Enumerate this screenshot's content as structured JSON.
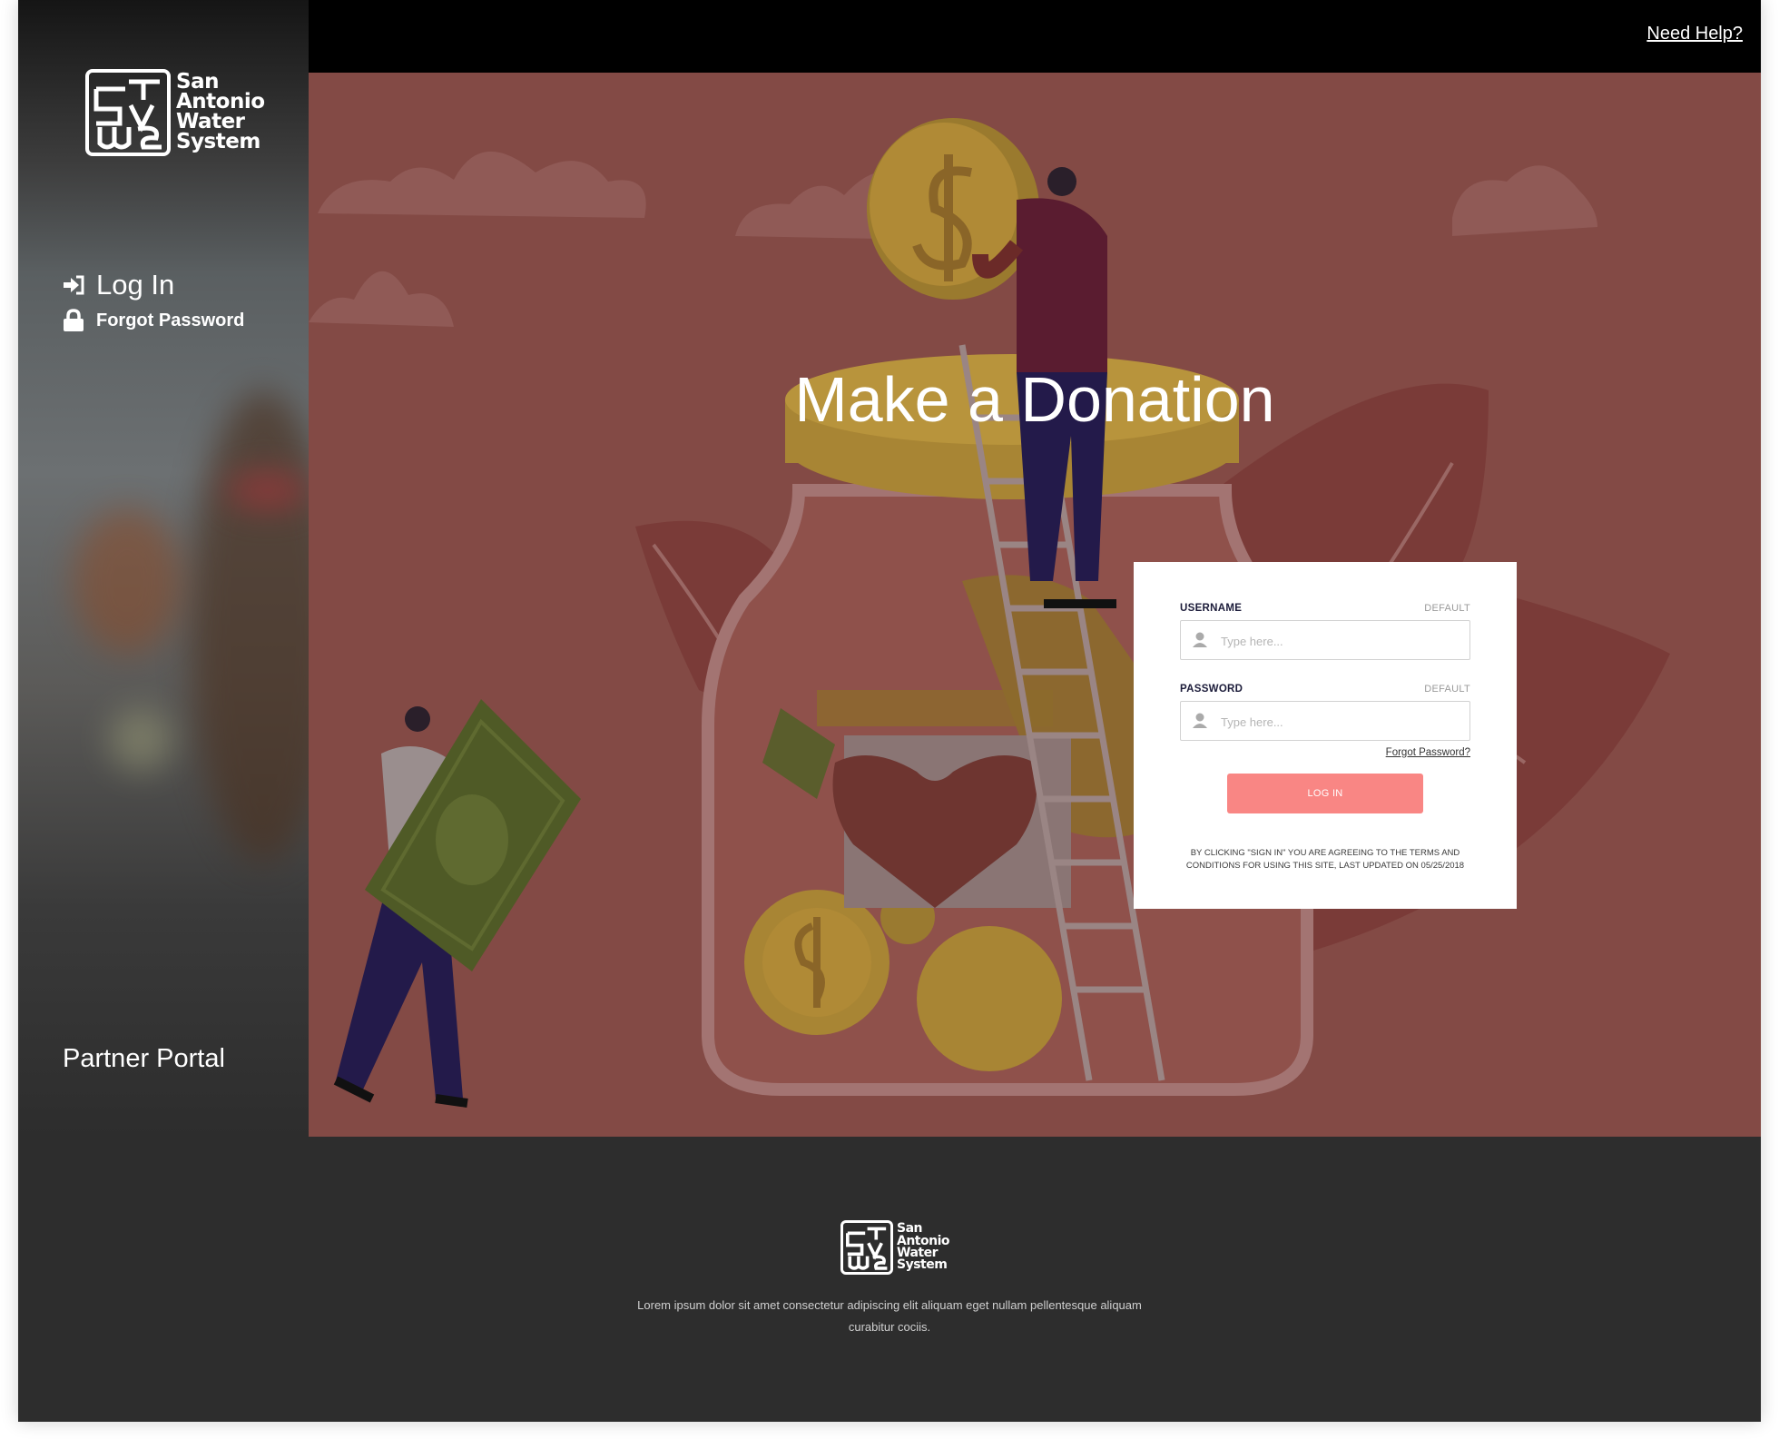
{
  "brand": {
    "name_lines": [
      "San",
      "Antonio",
      "Water",
      "System"
    ],
    "logo_mark": "saws-logo-mark"
  },
  "sidebar": {
    "items": [
      {
        "label": "Log In",
        "icon": "sign-in-icon"
      },
      {
        "label": "Forgot Password",
        "icon": "lock-icon"
      }
    ],
    "portal_label": "Partner Portal"
  },
  "topbar": {
    "help_link": "Need Help?"
  },
  "hero": {
    "headline": "Make a Donation"
  },
  "login": {
    "username_label": "USERNAME",
    "username_hint": "DEFAULT",
    "username_placeholder": "Type here...",
    "password_label": "PASSWORD",
    "password_hint": "DEFAULT",
    "password_placeholder": "Type here...",
    "forgot_link": "Forgot Password?",
    "button_label": "LOG IN",
    "terms": "BY CLICKING \"SIGN IN\" YOU ARE AGREEING TO THE TERMS AND CONDITIONS FOR USING THIS SITE, LAST UPDATED ON 05/25/2018"
  },
  "footer": {
    "text": "Lorem ipsum dolor sit amet consectetur adipiscing elit aliquam eget nullam pellentesque aliquam curabitur cociis."
  },
  "colors": {
    "hero_bg": "#834a45",
    "button": "#f98684",
    "footer_bg": "#2d2d2d",
    "topbar_bg": "#000000"
  }
}
